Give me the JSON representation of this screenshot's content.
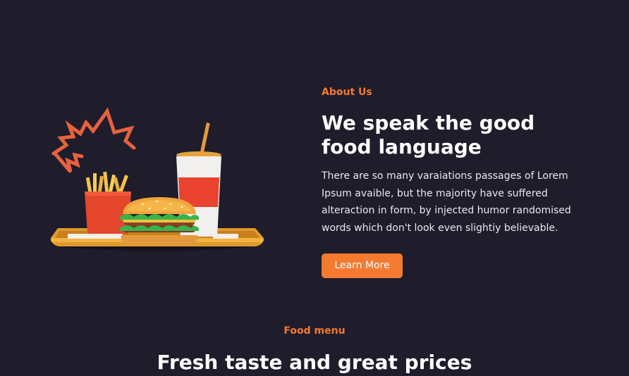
{
  "about": {
    "eyebrow": "About Us",
    "title": "We speak the good food language",
    "body": "There are so many varaiations passages of Lorem Ipsum avaible, but the majority have suffered alteraction in form, by injected humor randomised words which don't look even slightiy believable.",
    "button_label": "Learn More"
  },
  "menu": {
    "eyebrow": "Food menu",
    "title": "Fresh taste and great prices"
  },
  "colors": {
    "background": "#1f1d2b",
    "accent": "#f37a2f",
    "text": "#ffffff"
  },
  "illustration": {
    "icon": "fast-food-tray-illustration"
  }
}
